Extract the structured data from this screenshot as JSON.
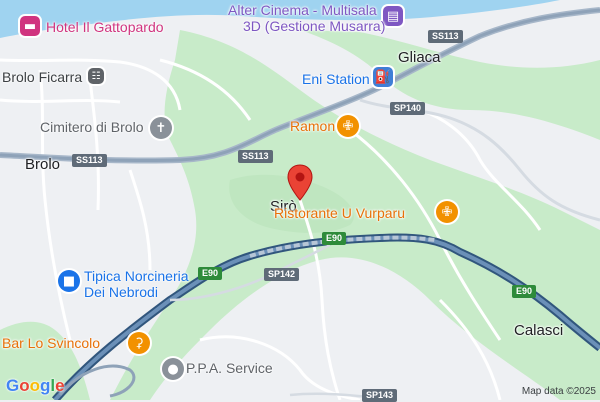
{
  "map": {
    "places": {
      "hotel": "Hotel Il Gattopardo",
      "cinema_line1": "Alter Cinema - Multisala",
      "cinema_line2": "3D (Gestione Musarra)",
      "brolo_ficarra": "Brolo Ficarra",
      "eni": "Eni Station",
      "gliaca": "Gliaca",
      "ramon": "Ramon",
      "cimitero": "Cimitero di Brolo",
      "brolo": "Brolo",
      "siro": "Sirò",
      "vurparu": "Ristorante U Vurparu",
      "norcineria_line1": "Tipica Norcineria",
      "norcineria_line2": "Dei Nebrodi",
      "calasci": "Calasci",
      "svincolo": "Bar Lo Svincolo",
      "ppa": "P.P.A. Service"
    },
    "road_shields": {
      "ss113_a": "SS113",
      "ss113_b": "SS113",
      "ss113_c": "SS113",
      "sp140": "SP140",
      "e90_a": "E90",
      "e90_b": "E90",
      "e90_c": "E90",
      "sp142": "SP142",
      "sp143": "SP143"
    },
    "icons": {
      "hotel": "hotel-icon",
      "cinema": "cinema-icon",
      "train": "train-station-icon",
      "fuel": "fuel-icon",
      "restaurant": "restaurant-icon",
      "cemetery": "cemetery-icon",
      "shop": "shop-icon",
      "bar": "bar-icon",
      "service": "service-icon",
      "pin": "location-pin-icon"
    },
    "colors": {
      "sea": "#9fd3f0",
      "land": "#eef0f3",
      "green": "#c8ebc9",
      "highway": "#5b7ea8",
      "pin": "#ea4335"
    },
    "logo": "Google",
    "attribution": "Map data ©2025"
  }
}
